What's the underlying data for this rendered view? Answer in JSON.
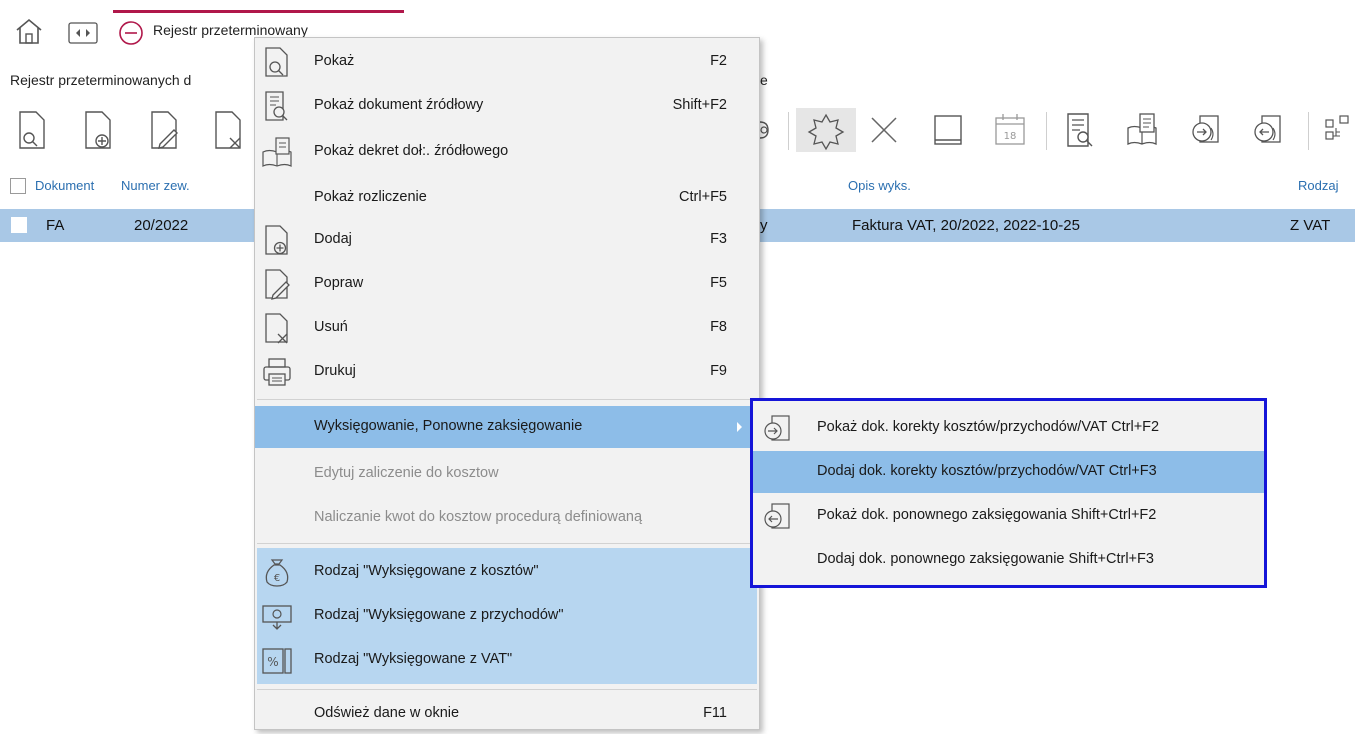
{
  "tab": {
    "title": "Rejestr przeterminowany"
  },
  "subtitle": {
    "text": "Rejestr przeterminowanych d",
    "tail": "e"
  },
  "toolbar": {
    "left_icons": [
      "document-search-icon",
      "document-add-icon",
      "document-edit-icon",
      "document-delete-icon"
    ],
    "right_icons": [
      "dok-icon",
      "wyksieg-star-icon",
      "close-x-icon",
      "book-icon",
      "calendar-icon",
      "document-view-icon",
      "book-document-icon",
      "correction-forward-icon",
      "correction-back-icon",
      "tree-icon"
    ],
    "calendar_day": "18"
  },
  "table": {
    "headers": {
      "dokument": "Dokument",
      "numer": "Numer zew.",
      "opis": "Opis wyks.",
      "rodzaj": "Rodzaj"
    },
    "rows": [
      {
        "dokument": "FA",
        "numer": "20/2022",
        "tail": "y",
        "opis": "Faktura VAT, 20/2022, 2022-10-25",
        "rodzaj": "Z VAT"
      }
    ]
  },
  "menu": {
    "items": [
      {
        "label": "Pokaż",
        "shortcut": "F2"
      },
      {
        "label": "Pokaż dokument źródłowy",
        "shortcut": "Shift+F2"
      },
      {
        "label": "Pokaż dekret doł:. źródłowego",
        "shortcut": ""
      },
      {
        "label": "Pokaż rozliczenie",
        "shortcut": "Ctrl+F5"
      },
      {
        "label": "Dodaj",
        "shortcut": "F3"
      },
      {
        "label": "Popraw",
        "shortcut": "F5"
      },
      {
        "label": "Usuń",
        "shortcut": "F8"
      },
      {
        "label": "Drukuj",
        "shortcut": "F9"
      },
      {
        "label": "Wyksięgowanie, Ponowne zaksięgowanie",
        "shortcut": ""
      },
      {
        "label": "Edytuj zaliczenie do kosztow",
        "shortcut": ""
      },
      {
        "label": "Naliczanie kwot do kosztow procedurą definiowaną",
        "shortcut": ""
      },
      {
        "label": "Rodzaj \"Wyksięgowane z kosztów\"",
        "shortcut": ""
      },
      {
        "label": "Rodzaj \"Wyksięgowane z przychodów\"",
        "shortcut": ""
      },
      {
        "label": "Rodzaj \"Wyksięgowane z VAT\"",
        "shortcut": ""
      },
      {
        "label": "Odśwież dane w oknie",
        "shortcut": "F11"
      }
    ]
  },
  "submenu": {
    "items": [
      {
        "label": "Pokaż dok. korekty kosztów/przychodów/VAT Ctrl+F2"
      },
      {
        "label": "Dodaj dok. korekty kosztów/przychodów/VAT Ctrl+F3"
      },
      {
        "label": "Pokaż dok. ponownego zaksięgowania  Shift+Ctrl+F2"
      },
      {
        "label": "Dodaj dok. ponownego zaksięgowanie  Shift+Ctrl+F3"
      }
    ]
  },
  "colors": {
    "selection": "#a9c8e6",
    "menu_hover": "#8dbde8",
    "menu_group": "#b7d6f0",
    "submenu_border": "#1515d8",
    "tab_accent": "#b0174a",
    "header_text": "#2b6fb0"
  }
}
